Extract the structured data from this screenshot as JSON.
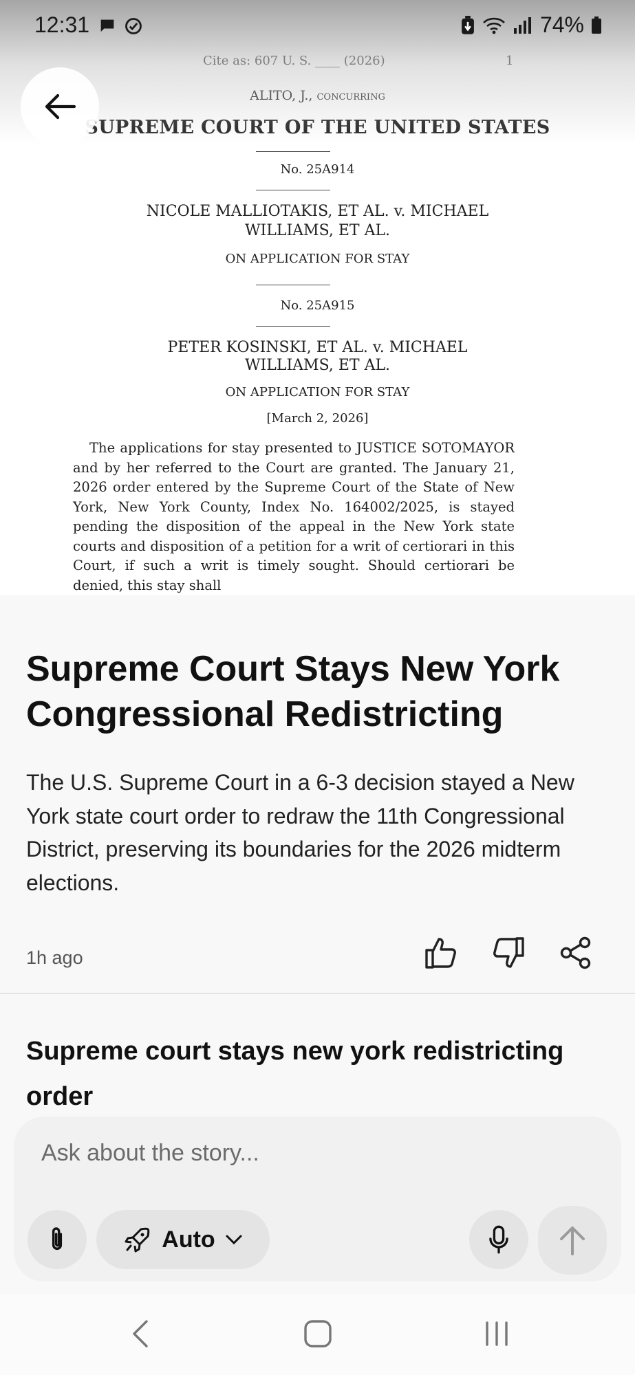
{
  "status_bar": {
    "time": "12:31",
    "battery": "74%",
    "left_icons": [
      "chat-bubble-icon",
      "check-circle-icon"
    ],
    "right_icons": [
      "battery-saver-icon",
      "wifi-icon",
      "signal-icon",
      "battery-icon"
    ]
  },
  "document": {
    "cite": "Cite as: 607 U. S. ____ (2026)",
    "page_number": "1",
    "concurring": "ALITO, J., concurring",
    "court": "SUPREME COURT OF THE UNITED STATES",
    "case1_number": "No. 25A914",
    "case1_parties_line1": "NICOLE MALLIOTAKIS, ET AL. v. MICHAEL",
    "case1_parties_line2": "WILLIAMS, ET AL.",
    "case1_application": "ON APPLICATION FOR STAY",
    "case2_number": "No. 25A915",
    "case2_parties_line1": "PETER KOSINSKI, ET AL. v. MICHAEL",
    "case2_parties_line2": "WILLIAMS, ET AL.",
    "case2_application": "ON APPLICATION FOR STAY",
    "date": "[March 2, 2026]",
    "body": "The applications for stay presented to JUSTICE SOTOMAYOR and by her referred to the Court are granted. The January 21, 2026 order entered by the Supreme Court of the State of New York, New York County, Index No. 164002/2025, is stayed pending the disposition of the appeal in the New York state courts and disposition of a petition for a writ of certiorari in this Court, if such a writ is timely sought. Should certiorari be denied, this stay shall"
  },
  "article": {
    "headline": "Supreme Court Stays New York Congressional Redistricting",
    "summary": "The U.S. Supreme Court in a 6-3 decision stayed a New York state court order to redraw the 11th Congressional District, preserving its boundaries for the 2026 midterm elections.",
    "time_ago": "1h ago",
    "related_title": "Supreme court stays new york redistricting order"
  },
  "ask_box": {
    "placeholder": "Ask about the story...",
    "mode_label": "Auto"
  },
  "colors": {
    "background": "#f8f8f8",
    "text": "#111111",
    "muted": "#555555",
    "pill": "#e4e4e4"
  }
}
